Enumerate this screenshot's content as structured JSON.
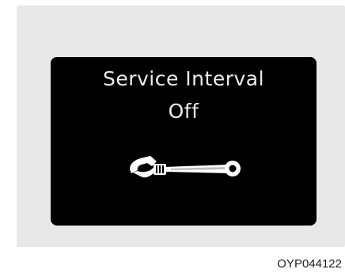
{
  "display": {
    "title": "Service Interval",
    "status": "Off",
    "icon": "wrench-icon"
  },
  "figure": {
    "code": "OYP044122"
  },
  "colors": {
    "panel": "#e8e8e9",
    "screen": "#000000",
    "text": "#ececec"
  }
}
